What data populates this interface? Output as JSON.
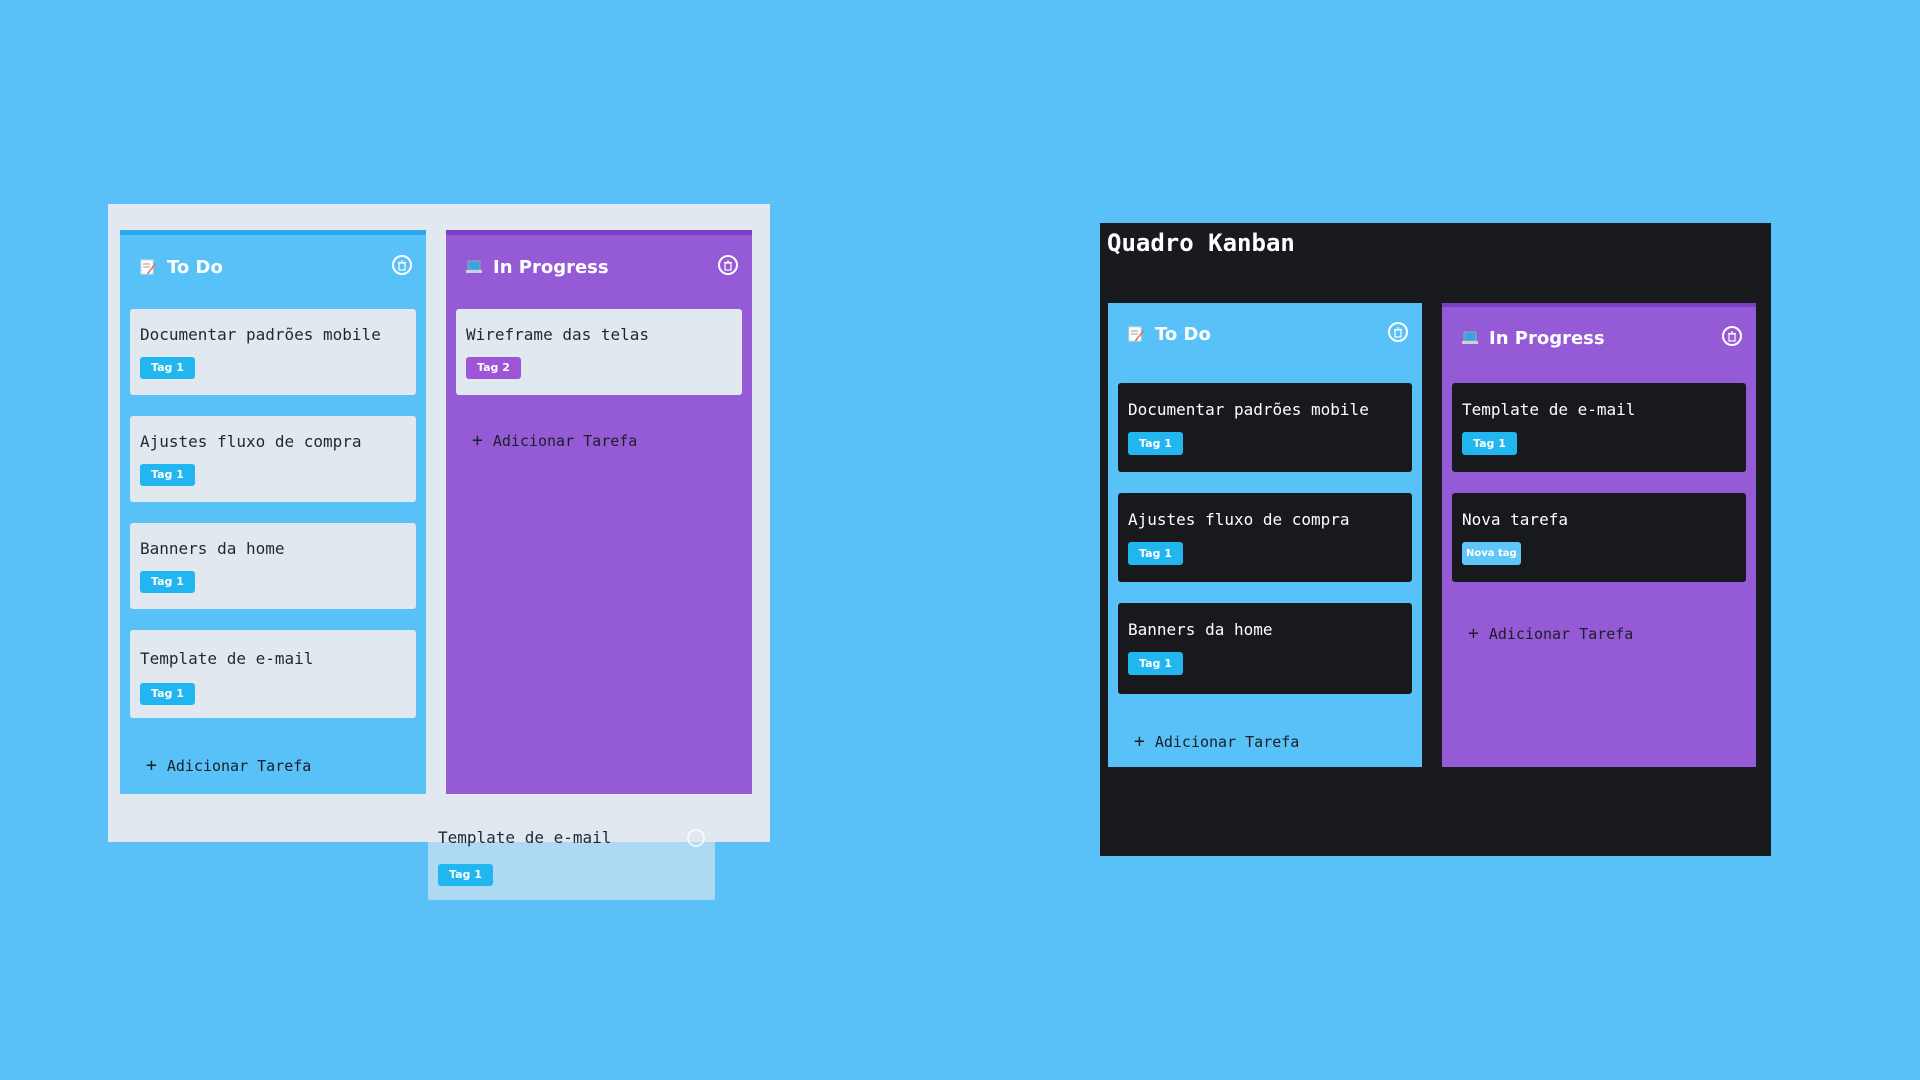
{
  "light_board": {
    "columns": [
      {
        "title": "To Do",
        "emoji": "memo-icon",
        "cards": [
          {
            "text": "Documentar padrões mobile",
            "tag": "Tag 1"
          },
          {
            "text": "Ajustes fluxo de compra",
            "tag": "Tag 1"
          },
          {
            "text": "Banners da home",
            "tag": "Tag 1"
          },
          {
            "text": "Template de e-mail",
            "tag": "Tag 1"
          }
        ],
        "add_label": "Adicionar Tarefa"
      },
      {
        "title": "In Progress",
        "emoji": "laptop-icon",
        "cards": [
          {
            "text": "Wireframe das telas",
            "tag": "Tag 2"
          }
        ],
        "add_label": "Adicionar Tarefa"
      }
    ],
    "drag_ghost": {
      "text": "Template de e-mail",
      "tag": "Tag 1"
    }
  },
  "dark_board": {
    "title": "Quadro Kanban",
    "columns": [
      {
        "title": "To Do",
        "emoji": "memo-icon",
        "cards": [
          {
            "text": "Documentar padrões mobile",
            "tag": "Tag 1"
          },
          {
            "text": "Ajustes fluxo de compra",
            "tag": "Tag 1"
          },
          {
            "text": "Banners da home",
            "tag": "Tag 1"
          }
        ],
        "add_label": "Adicionar Tarefa"
      },
      {
        "title": "In Progress",
        "emoji": "laptop-icon",
        "cards": [
          {
            "text": "Template de e-mail",
            "tag": "Tag 1"
          },
          {
            "text": "Nova tarefa",
            "tag": "Nova tag"
          }
        ],
        "add_label": "Adicionar Tarefa"
      }
    ]
  },
  "colors": {
    "background": "#5ac0f8",
    "todo_column": "#58c1f8",
    "progress_column": "#955ad6",
    "tag_blue": "#22b6f0",
    "tag_purple": "#9b55d6",
    "dark_board": "#191a1e",
    "light_board": "#e2e8f0"
  }
}
